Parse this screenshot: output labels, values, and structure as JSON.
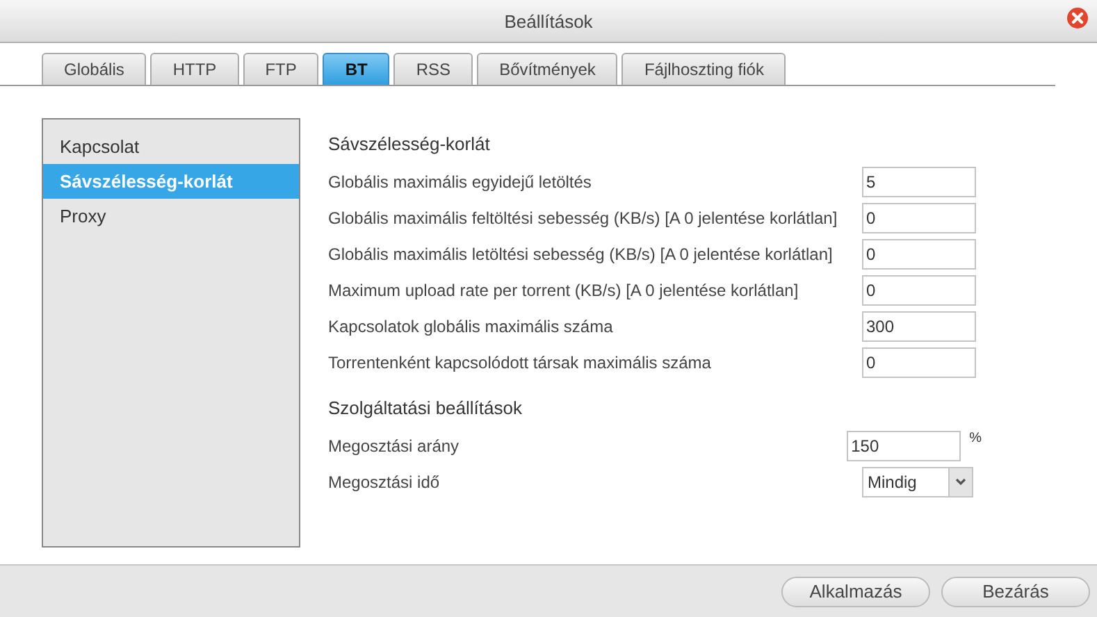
{
  "window": {
    "title": "Beállítások"
  },
  "tabs": [
    {
      "label": "Globális",
      "selected": false
    },
    {
      "label": "HTTP",
      "selected": false
    },
    {
      "label": "FTP",
      "selected": false
    },
    {
      "label": "BT",
      "selected": true
    },
    {
      "label": "RSS",
      "selected": false
    },
    {
      "label": "Bővítmények",
      "selected": false
    },
    {
      "label": "Fájlhoszting fiók",
      "selected": false
    }
  ],
  "sidebar": {
    "items": [
      {
        "label": "Kapcsolat",
        "selected": false
      },
      {
        "label": "Sávszélesség-korlát",
        "selected": true
      },
      {
        "label": "Proxy",
        "selected": false
      }
    ]
  },
  "sections": [
    {
      "heading": "Sávszélesség-korlát",
      "rows": [
        {
          "kind": "text",
          "label": "Globális maximális egyidejű letöltés",
          "value": "5"
        },
        {
          "kind": "text",
          "label": "Globális maximális feltöltési sebesség (KB/s) [A 0 jelentése korlátlan]",
          "value": "0"
        },
        {
          "kind": "text",
          "label": "Globális maximális letöltési sebesség (KB/s) [A 0 jelentése korlátlan]",
          "value": "0"
        },
        {
          "kind": "text",
          "label": "Maximum upload rate per torrent (KB/s) [A 0 jelentése korlátlan]",
          "value": "0"
        },
        {
          "kind": "text",
          "label": "Kapcsolatok globális maximális száma",
          "value": "300"
        },
        {
          "kind": "text",
          "label": "Torrentenként kapcsolódott társak maximális száma",
          "value": "0"
        }
      ]
    },
    {
      "heading": "Szolgáltatási beállítások",
      "rows": [
        {
          "kind": "text",
          "label": "Megosztási arány",
          "value": "150",
          "unit": "%"
        },
        {
          "kind": "select",
          "label": "Megosztási idő",
          "value": "Mindig"
        }
      ]
    }
  ],
  "buttons": [
    "Alkalmazás",
    "Bezárás"
  ]
}
